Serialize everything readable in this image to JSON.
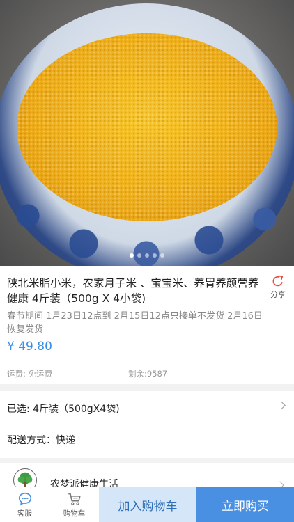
{
  "product": {
    "title": "陕北米脂小米，农家月子米 、宝宝米、养胃养颜营养健康 4斤装（500g X 4小袋)",
    "notice": "春节期间 1月23日12点到 2月15日12点只接单不发货 2月16日恢复发货",
    "price": "¥ 49.80",
    "freight": "运费: 免运费",
    "stock": "剩余:9587",
    "image_description": "bowl of yellow millet"
  },
  "share": {
    "label": "分享",
    "icon": "share-icon",
    "color": "#e64a3c"
  },
  "carousel": {
    "total": 5,
    "active_index": 0
  },
  "selection": {
    "selected_text": "已选: 4斤装（500gX4袋)",
    "delivery_text": "配送方式：快递"
  },
  "store": {
    "name": "农梦派健康生活",
    "logo_icon": "tree-icon"
  },
  "bottom_bar": {
    "service_label": "客服",
    "cart_label": "购物车",
    "add_to_cart_label": "加入购物车",
    "buy_now_label": "立即购买"
  },
  "colors": {
    "accent": "#4a90e2",
    "accent_light": "#d5e6f8",
    "price": "#3a8ee6"
  }
}
